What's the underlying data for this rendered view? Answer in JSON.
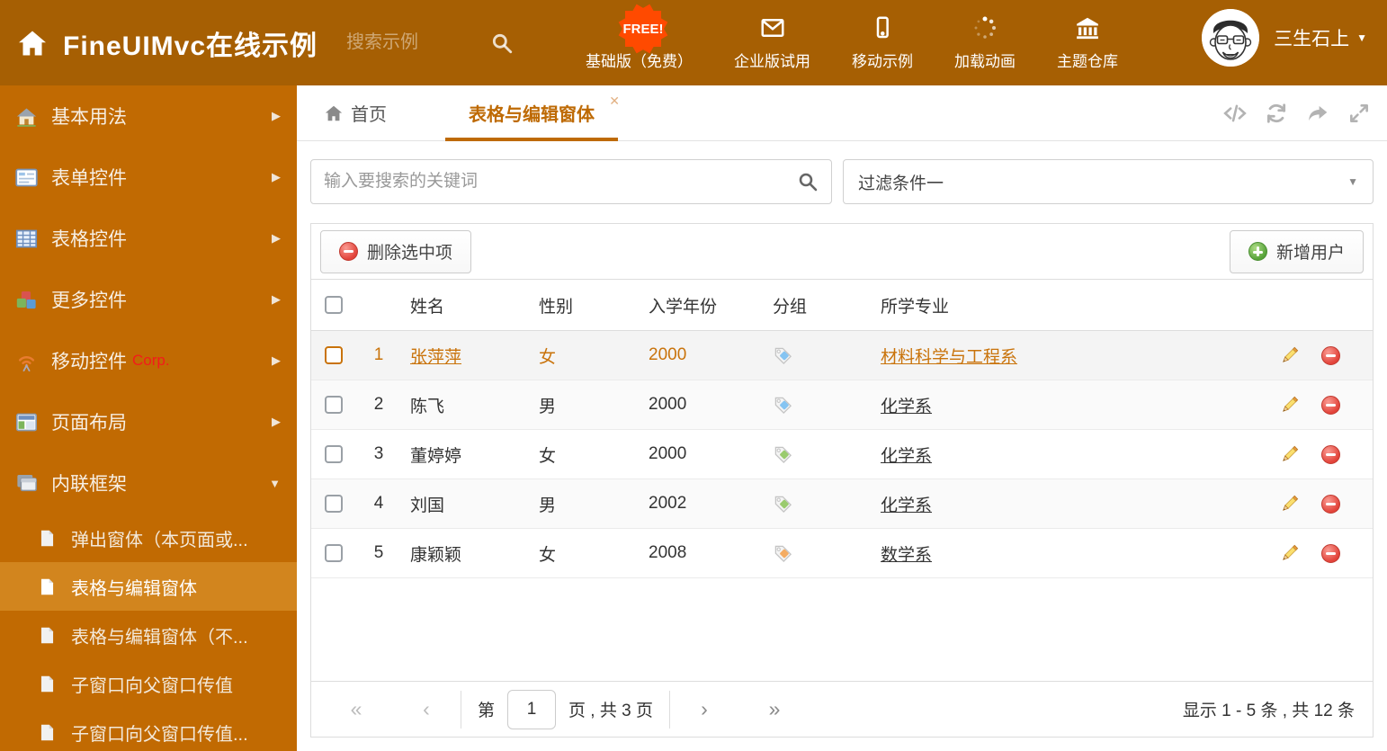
{
  "header": {
    "title": "FineUIMvc在线示例",
    "search_placeholder": "搜索示例",
    "free_badge": "FREE!",
    "nav_items": [
      {
        "label": "基础版（免费）",
        "icon": "download-icon"
      },
      {
        "label": "企业版试用",
        "icon": "mail-icon"
      },
      {
        "label": "移动示例",
        "icon": "mobile-icon"
      },
      {
        "label": "加载动画",
        "icon": "spinner-icon"
      },
      {
        "label": "主题仓库",
        "icon": "bank-icon"
      }
    ],
    "user_name": "三生石上"
  },
  "sidebar": {
    "items": [
      {
        "label": "基本用法",
        "icon": "home"
      },
      {
        "label": "表单控件",
        "icon": "form"
      },
      {
        "label": "表格控件",
        "icon": "table"
      },
      {
        "label": "更多控件",
        "icon": "cubes"
      },
      {
        "label": "移动控件",
        "badge": "Corp.",
        "icon": "signal"
      },
      {
        "label": "页面布局",
        "icon": "layout"
      },
      {
        "label": "内联框架",
        "icon": "frames",
        "expanded": true
      }
    ],
    "subitems": [
      {
        "label": "弹出窗体（本页面或...",
        "active": false
      },
      {
        "label": "表格与编辑窗体",
        "active": true
      },
      {
        "label": "表格与编辑窗体（不...",
        "active": false
      },
      {
        "label": "子窗口向父窗口传值",
        "active": false
      },
      {
        "label": "子窗口向父窗口传值...",
        "active": false
      }
    ]
  },
  "tabs": [
    {
      "label": "首页",
      "active": false
    },
    {
      "label": "表格与编辑窗体",
      "active": true,
      "closable": true
    }
  ],
  "filter": {
    "search_placeholder": "输入要搜索的关键词",
    "dropdown_value": "过滤条件一"
  },
  "toolbar": {
    "delete_label": "删除选中项",
    "add_label": "新增用户"
  },
  "table": {
    "columns": {
      "name": "姓名",
      "gender": "性别",
      "year": "入学年份",
      "group": "分组",
      "major": "所学专业"
    },
    "rows": [
      {
        "num": "1",
        "name": "张萍萍",
        "gender": "女",
        "year": "2000",
        "tag_color": "#85C4F2",
        "major": "材料科学与工程系",
        "highlighted": true
      },
      {
        "num": "2",
        "name": "陈飞",
        "gender": "男",
        "year": "2000",
        "tag_color": "#85C4F2",
        "major": "化学系",
        "highlighted": false
      },
      {
        "num": "3",
        "name": "董婷婷",
        "gender": "女",
        "year": "2000",
        "tag_color": "#9ACB6E",
        "major": "化学系",
        "highlighted": false
      },
      {
        "num": "4",
        "name": "刘国",
        "gender": "男",
        "year": "2002",
        "tag_color": "#9ACB6E",
        "major": "化学系",
        "highlighted": false
      },
      {
        "num": "5",
        "name": "康颖颖",
        "gender": "女",
        "year": "2008",
        "tag_color": "#F4AC62",
        "major": "数学系",
        "highlighted": false
      }
    ]
  },
  "pagination": {
    "page_prefix": "第",
    "page_value": "1",
    "page_suffix": "页 , 共 3 页",
    "summary": "显示 1 - 5 条 , 共 12 条"
  },
  "icons": {
    "caret_down": "▼",
    "caret_right": "▶",
    "close": "✕",
    "first": "«",
    "prev": "‹",
    "next": "›",
    "last": "»"
  },
  "colors": {
    "header_bg": "#A65F03",
    "sidebar_bg": "#C16A02",
    "accent": "#BE6A04",
    "free_badge": "#FF4A00",
    "row_highlight_text": "#C9730B"
  }
}
